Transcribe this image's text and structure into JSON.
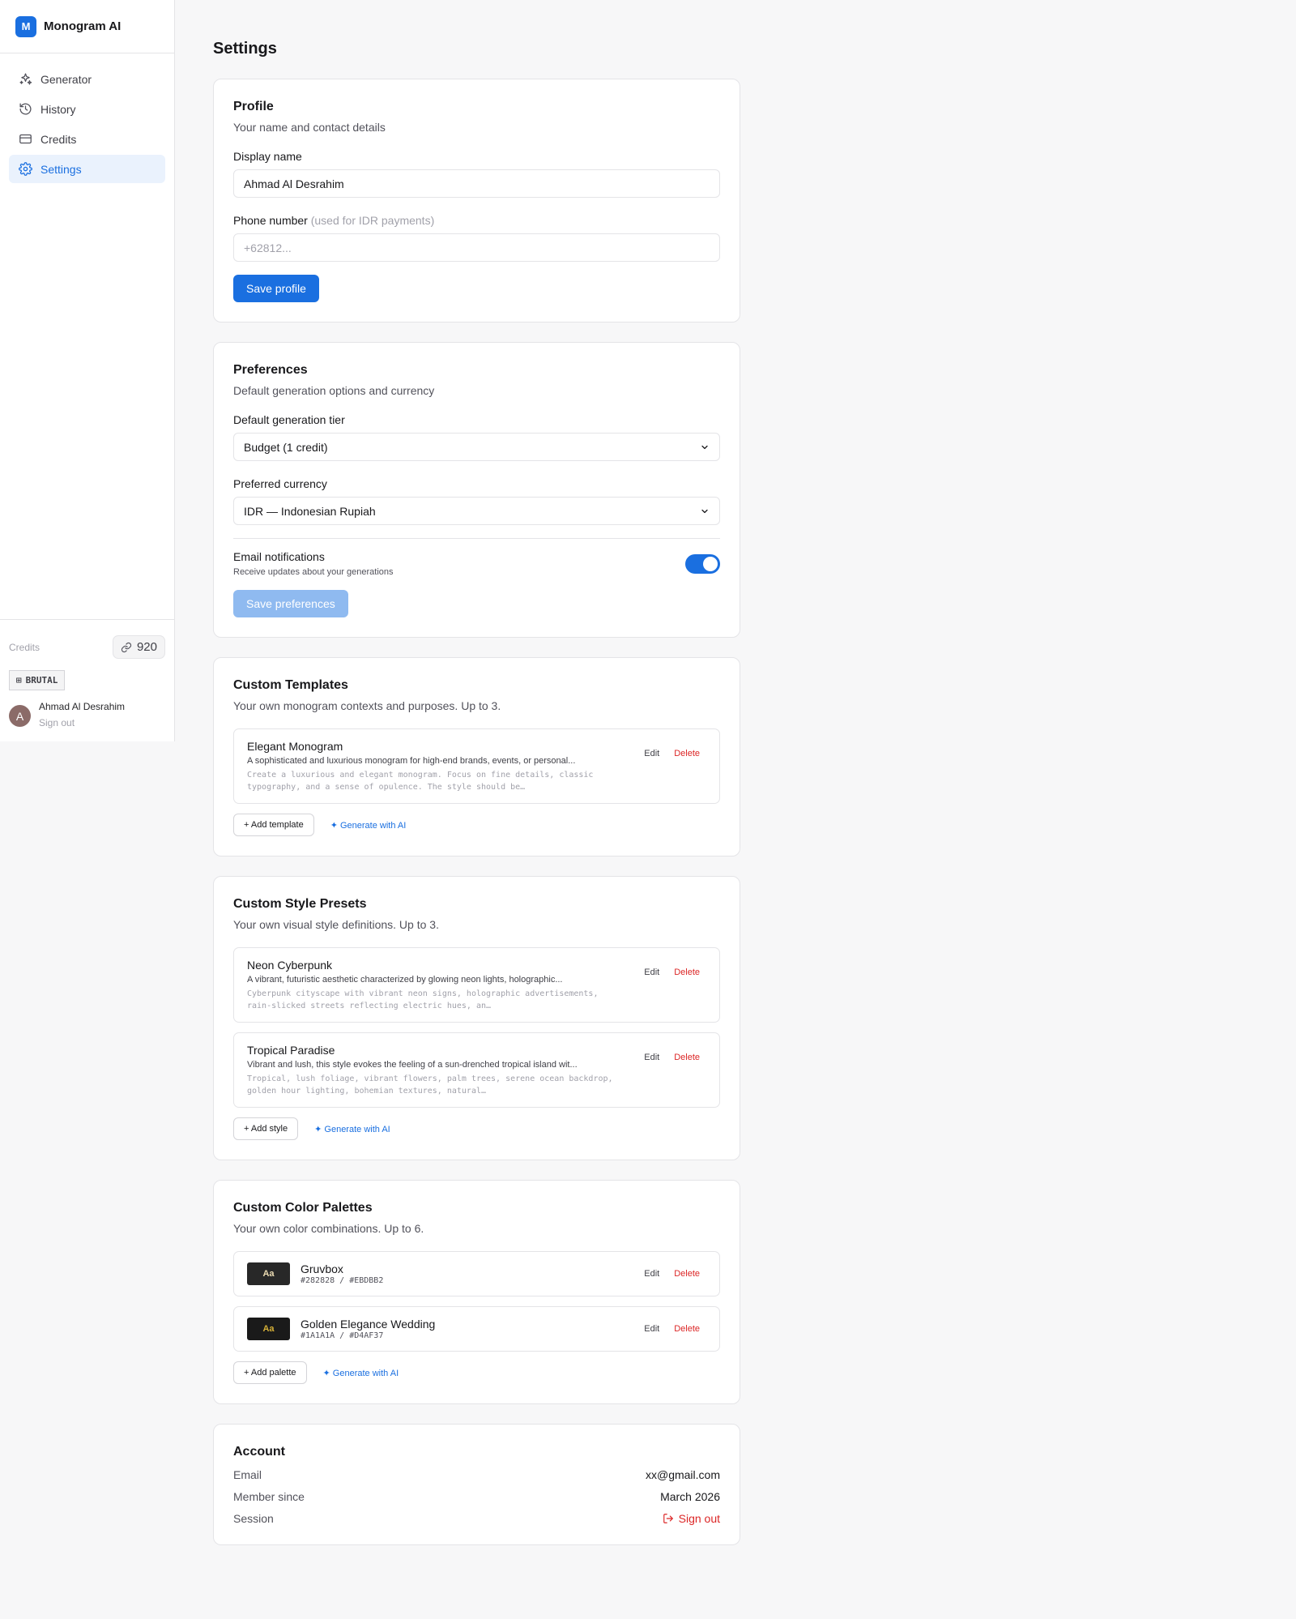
{
  "app": {
    "logo_letter": "M",
    "name": "Monogram AI"
  },
  "nav": [
    {
      "label": "Generator",
      "icon": "sparkles-icon",
      "active": false
    },
    {
      "label": "History",
      "icon": "history-icon",
      "active": false
    },
    {
      "label": "Credits",
      "icon": "credit-card-icon",
      "active": false
    },
    {
      "label": "Settings",
      "icon": "gear-icon",
      "active": true
    }
  ],
  "sidebar_footer": {
    "credits_label": "Credits",
    "credits_value": "920",
    "badge": "BRUTAL",
    "avatar_letter": "A",
    "user_name": "Ahmad Al Desrahim",
    "sign_out": "Sign out"
  },
  "page_title": "Settings",
  "profile": {
    "title": "Profile",
    "subtitle": "Your name and contact details",
    "display_name_label": "Display name",
    "display_name_value": "Ahmad Al Desrahim",
    "phone_label": "Phone number",
    "phone_hint": "(used for IDR payments)",
    "phone_placeholder": "+62812...",
    "save_label": "Save profile"
  },
  "preferences": {
    "title": "Preferences",
    "subtitle": "Default generation options and currency",
    "tier_label": "Default generation tier",
    "tier_value": "Budget (1 credit)",
    "currency_label": "Preferred currency",
    "currency_value": "IDR — Indonesian Rupiah",
    "email_notif_title": "Email notifications",
    "email_notif_sub": "Receive updates about your generations",
    "email_notif_on": true,
    "save_label": "Save preferences"
  },
  "templates": {
    "title": "Custom Templates",
    "subtitle": "Your own monogram contexts and purposes. Up to 3.",
    "items": [
      {
        "name": "Elegant Monogram",
        "desc": "A sophisticated and luxurious monogram for high-end brands, events, or personal...",
        "prompt": "Create a luxurious and elegant monogram. Focus on fine details, classic typography, and a sense of opulence. The style should be…"
      }
    ],
    "edit_label": "Edit",
    "delete_label": "Delete",
    "add_label": "+ Add template",
    "ai_label": "✦ Generate with AI"
  },
  "styles": {
    "title": "Custom Style Presets",
    "subtitle": "Your own visual style definitions. Up to 3.",
    "items": [
      {
        "name": "Neon Cyberpunk",
        "desc": "A vibrant, futuristic aesthetic characterized by glowing neon lights, holographic...",
        "prompt": "Cyberpunk cityscape with vibrant neon signs, holographic advertisements, rain-slicked streets reflecting electric hues, an…"
      },
      {
        "name": "Tropical Paradise",
        "desc": "Vibrant and lush, this style evokes the feeling of a sun-drenched tropical island wit...",
        "prompt": "Tropical, lush foliage, vibrant flowers, palm trees, serene ocean backdrop, golden hour lighting, bohemian textures, natural…"
      }
    ],
    "edit_label": "Edit",
    "delete_label": "Delete",
    "add_label": "+ Add style",
    "ai_label": "✦ Generate with AI"
  },
  "palettes": {
    "title": "Custom Color Palettes",
    "subtitle": "Your own color combinations. Up to 6.",
    "items": [
      {
        "swatch_text": "Aa",
        "name": "Gruvbox",
        "hex": "#282828 / #EBDBB2",
        "bg": "#282828",
        "fg": "#EBDBB2"
      },
      {
        "swatch_text": "Aa",
        "name": "Golden Elegance Wedding",
        "hex": "#1A1A1A / #D4AF37",
        "bg": "#1A1A1A",
        "fg": "#D4AF37"
      }
    ],
    "edit_label": "Edit",
    "delete_label": "Delete",
    "add_label": "+ Add palette",
    "ai_label": "✦ Generate with AI"
  },
  "account": {
    "title": "Account",
    "email_label": "Email",
    "email_value": "xx@gmail.com",
    "member_label": "Member since",
    "member_value": "March 2026",
    "session_label": "Session",
    "session_action": "Sign out"
  },
  "colors": {
    "accent": "#1A6FE0",
    "danger": "#DC2626"
  }
}
